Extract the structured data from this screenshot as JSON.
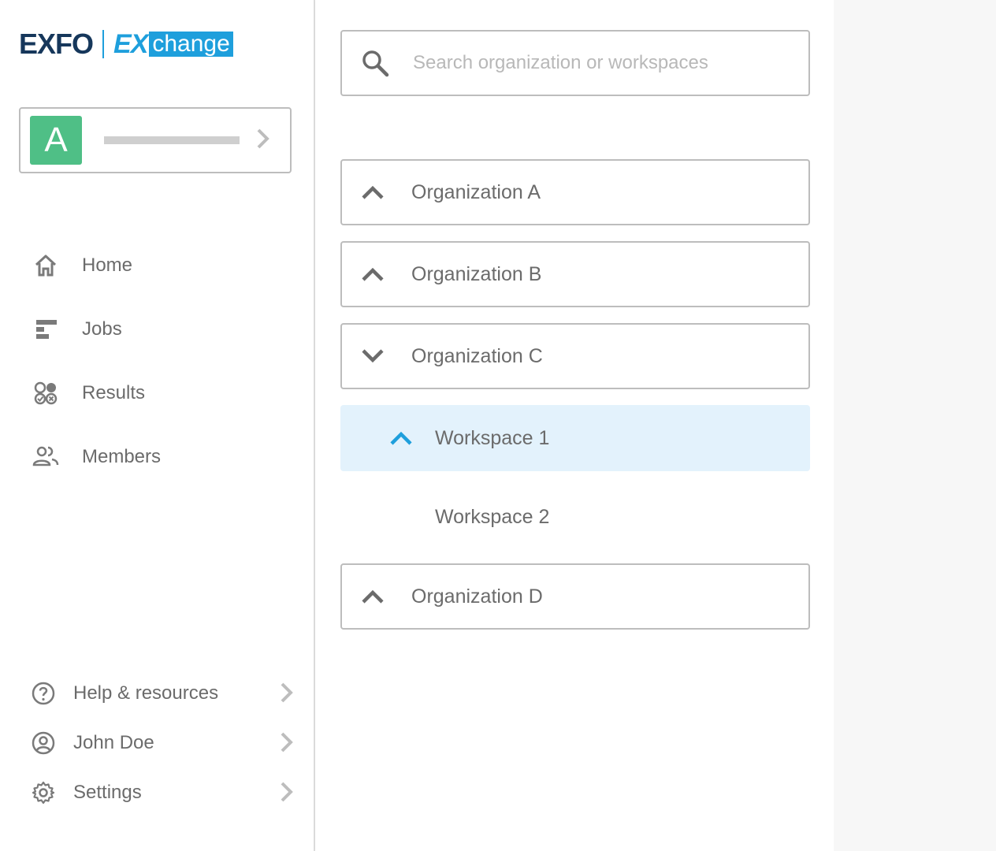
{
  "brand": {
    "name": "EXFO",
    "product_prefix": "EX",
    "product_suffix": "change",
    "colors": {
      "navy": "#16375b",
      "blue": "#1e9fdc"
    }
  },
  "org_switcher": {
    "avatar_letter": "A",
    "avatar_color": "#4fbf86"
  },
  "nav": {
    "items": [
      {
        "label": "Home",
        "icon": "home-icon"
      },
      {
        "label": "Jobs",
        "icon": "jobs-icon"
      },
      {
        "label": "Results",
        "icon": "results-icon"
      },
      {
        "label": "Members",
        "icon": "members-icon"
      }
    ]
  },
  "footer": {
    "items": [
      {
        "label": "Help & resources",
        "icon": "help-icon"
      },
      {
        "label": "John Doe",
        "icon": "user-icon"
      },
      {
        "label": "Settings",
        "icon": "gear-icon"
      }
    ]
  },
  "search": {
    "placeholder": "Search organization or workspaces",
    "value": ""
  },
  "tree": {
    "organizations": [
      {
        "label": "Organization A",
        "state": "collapsed"
      },
      {
        "label": "Organization B",
        "state": "collapsed"
      },
      {
        "label": "Organization C",
        "state": "expanded"
      },
      {
        "label": "Organization D",
        "state": "collapsed"
      }
    ],
    "workspaces": [
      {
        "label": "Workspace 1",
        "selected": true
      },
      {
        "label": "Workspace 2",
        "selected": false
      }
    ]
  }
}
